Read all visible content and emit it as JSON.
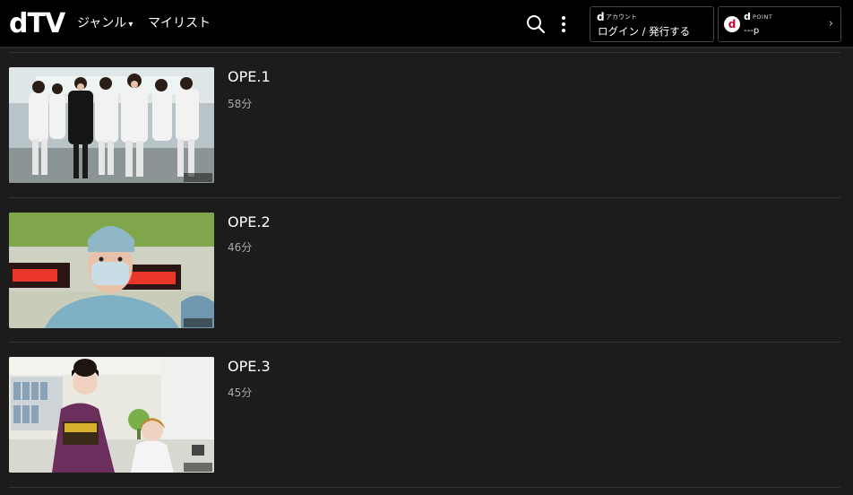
{
  "header": {
    "logo": "dTV",
    "nav": {
      "genre": "ジャンル",
      "genre_caret": "▾",
      "mylist": "マイリスト"
    },
    "account": {
      "d_mark": "d",
      "small_label": "アカウント",
      "login_label": "ログイン / 発行する"
    },
    "point": {
      "badge": "d",
      "d_mark": "d",
      "small_label": "POINT",
      "value": "---p",
      "chevron": "›"
    },
    "icons": {
      "search": "search-icon",
      "more": "more-vertical-icon"
    }
  },
  "episodes": [
    {
      "title": "OPE.1",
      "duration": "58分",
      "thumb_badge": "テレ朝"
    },
    {
      "title": "OPE.2",
      "duration": "46分",
      "thumb_badge": "テレ朝"
    },
    {
      "title": "OPE.3",
      "duration": "45分",
      "thumb_badge": "テレ朝"
    }
  ],
  "colors": {
    "header_bg": "#000000",
    "page_bg": "#1c1c1c",
    "point_red": "#cc0033"
  }
}
